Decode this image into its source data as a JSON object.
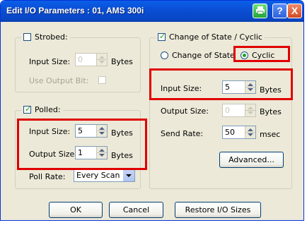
{
  "window": {
    "title": "Edit I/O Parameters : 01, AMS 300i",
    "help_label": "?",
    "close_label": "X"
  },
  "strobed": {
    "label": "Strobed:",
    "checked": false,
    "input_size_label": "Input Size:",
    "input_size_value": "0",
    "bytes_label": "Bytes",
    "use_output_bit_label": "Use Output Bit:"
  },
  "polled": {
    "label": "Polled:",
    "checked": true,
    "input_size_label": "Input Size:",
    "input_size_value": "5",
    "input_bytes_label": "Bytes",
    "output_size_label": "Output Size:",
    "output_size_value": "1",
    "output_bytes_label": "Bytes",
    "poll_rate_label": "Poll Rate:",
    "poll_rate_value": "Every Scan"
  },
  "cos": {
    "label": "Change of State / Cyclic",
    "checked": true,
    "radio_change_label": "Change of State",
    "radio_cyclic_label": "Cyclic",
    "selected": "Cyclic",
    "input_size_label": "Input Size:",
    "input_size_value": "5",
    "input_bytes_label": "Bytes",
    "output_size_label": "Output Size:",
    "output_size_value": "0",
    "output_bytes_label": "Bytes",
    "send_rate_label": "Send Rate:",
    "send_rate_value": "50",
    "send_rate_unit": "msec",
    "advanced_label": "Advanced..."
  },
  "buttons": {
    "ok": "OK",
    "cancel": "Cancel",
    "restore": "Restore I/O Sizes"
  },
  "colors": {
    "highlight": "#e00000",
    "titlebar": "#0a4fd6",
    "dialog_bg": "#ece9d8"
  }
}
